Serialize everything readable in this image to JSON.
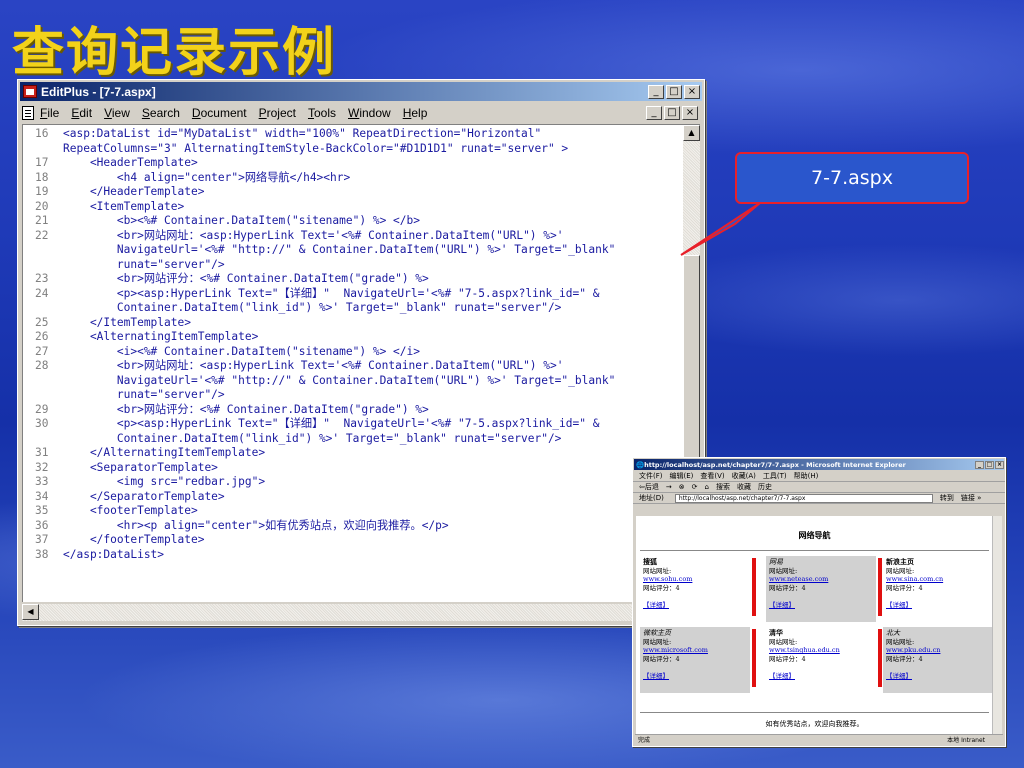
{
  "slide": {
    "title": "查询记录示例"
  },
  "editplus": {
    "title": "EditPlus - [7-7.aspx]",
    "window_buttons": [
      "_",
      "□",
      "×"
    ],
    "menu": [
      "File",
      "Edit",
      "View",
      "Search",
      "Document",
      "Project",
      "Tools",
      "Window",
      "Help"
    ],
    "lines": [
      {
        "n": "16",
        "t": "<asp:DataList id=\"MyDataList\" width=\"100%\" RepeatDirection=\"Horizontal\""
      },
      {
        "n": "",
        "t": "RepeatColumns=\"3\" AlternatingItemStyle-BackColor=\"#D1D1D1\" runat=\"server\" >"
      },
      {
        "n": "17",
        "t": "    <HeaderTemplate>"
      },
      {
        "n": "18",
        "t": "        <h4 align=\"center\">网络导航</h4><hr>"
      },
      {
        "n": "19",
        "t": "    </HeaderTemplate>"
      },
      {
        "n": "20",
        "t": "    <ItemTemplate>"
      },
      {
        "n": "21",
        "t": "        <b><%# Container.DataItem(\"sitename\") %> </b>"
      },
      {
        "n": "22",
        "t": "        <br>网站网址：<asp:HyperLink Text='<%# Container.DataItem(\"URL\") %>'"
      },
      {
        "n": "",
        "t": "        NavigateUrl='<%# \"http://\" & Container.DataItem(\"URL\") %>' Target=\"_blank\""
      },
      {
        "n": "",
        "t": "        runat=\"server\"/>"
      },
      {
        "n": "23",
        "t": "        <br>网站评分：<%# Container.DataItem(\"grade\") %>"
      },
      {
        "n": "24",
        "t": "        <p><asp:HyperLink Text=\"【详细】\"  NavigateUrl='<%# \"7-5.aspx?link_id=\" &"
      },
      {
        "n": "",
        "t": "        Container.DataItem(\"link_id\") %>' Target=\"_blank\" runat=\"server\"/>"
      },
      {
        "n": "25",
        "t": "    </ItemTemplate>"
      },
      {
        "n": "26",
        "t": "    <AlternatingItemTemplate>"
      },
      {
        "n": "27",
        "t": "        <i><%# Container.DataItem(\"sitename\") %> </i>"
      },
      {
        "n": "28",
        "t": "        <br>网站网址：<asp:HyperLink Text='<%# Container.DataItem(\"URL\") %>'"
      },
      {
        "n": "",
        "t": "        NavigateUrl='<%# \"http://\" & Container.DataItem(\"URL\") %>' Target=\"_blank\""
      },
      {
        "n": "",
        "t": "        runat=\"server\"/>"
      },
      {
        "n": "29",
        "t": "        <br>网站评分：<%# Container.DataItem(\"grade\") %>"
      },
      {
        "n": "30",
        "t": "        <p><asp:HyperLink Text=\"【详细】\"  NavigateUrl='<%# \"7-5.aspx?link_id=\" &"
      },
      {
        "n": "",
        "t": "        Container.DataItem(\"link_id\") %>' Target=\"_blank\" runat=\"server\"/>"
      },
      {
        "n": "31",
        "t": "    </AlternatingItemTemplate>"
      },
      {
        "n": "32",
        "t": "    <SeparatorTemplate>"
      },
      {
        "n": "33",
        "t": "        <img src=\"redbar.jpg\">"
      },
      {
        "n": "34",
        "t": "    </SeparatorTemplate>"
      },
      {
        "n": "35",
        "t": "    <footerTemplate>"
      },
      {
        "n": "36",
        "t": "        <hr><p align=\"center\">如有优秀站点，欢迎向我推荐。</p>"
      },
      {
        "n": "37",
        "t": "    </footerTemplate>"
      },
      {
        "n": "38",
        "t": "</asp:DataList>"
      }
    ]
  },
  "callout": {
    "label": "7-7.aspx"
  },
  "ie": {
    "title": "http://localhost/asp.net/chapter7/7-7.aspx - Microsoft Internet Explorer",
    "menu": [
      "文件(F)",
      "编辑(E)",
      "查看(V)",
      "收藏(A)",
      "工具(T)",
      "帮助(H)"
    ],
    "toolbar": [
      "⇦后退",
      "→",
      "⊗",
      "⟳",
      "⌂",
      "搜索",
      "收藏",
      "历史"
    ],
    "address_label": "地址(D)",
    "address": "http://localhost/asp.net/chapter7/7-7.aspx",
    "go_label": "转到",
    "links_label": "链接 »",
    "heading": "网络导航",
    "sites": [
      {
        "name": "搜狐",
        "url_label": "网站网址:",
        "url": "www.sohu.com",
        "grade": "网站评分：4",
        "detail": "【详细】",
        "alt": false
      },
      {
        "name": "网易",
        "url_label": "网站网址:",
        "url": "www.netease.com",
        "grade": "网站评分：4",
        "detail": "【详细】",
        "alt": true
      },
      {
        "name": "新浪主页",
        "url_label": "网站网址:",
        "url": "www.sina.com.cn",
        "grade": "网站评分：4",
        "detail": "【详细】",
        "alt": false
      },
      {
        "name": "微软主页",
        "url_label": "网站网址:",
        "url": "www.microsoft.com",
        "grade": "网站评分：4",
        "detail": "【详细】",
        "alt": true
      },
      {
        "name": "清华",
        "url_label": "网站网址:",
        "url": "www.tsinghua.edu.cn",
        "grade": "网站评分：4",
        "detail": "【详细】",
        "alt": false
      },
      {
        "name": "北大",
        "url_label": "网站网址:",
        "url": "www.pku.edu.cn",
        "grade": "网站评分：4",
        "detail": "【详细】",
        "alt": true
      }
    ],
    "footer": "如有优秀站点，欢迎向我推荐。",
    "status_left": "完成",
    "status_right": "本地 Intranet"
  }
}
